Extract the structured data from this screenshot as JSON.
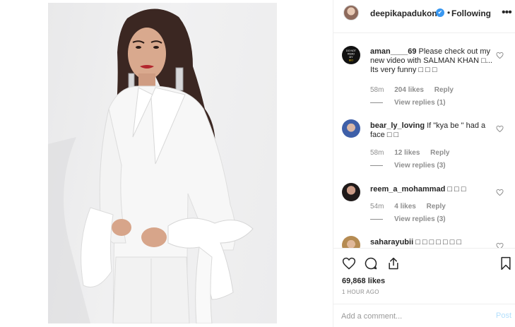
{
  "post": {
    "image_label": "Woman in white shirt with bow cuffs posing against a light gray background"
  },
  "header": {
    "username": "deepikapadukone",
    "dot": "•",
    "follow_status": "Following",
    "more_icon": "•••"
  },
  "comments": [
    {
      "username": "aman____69",
      "text": "Please check out my new video with SALMAN KHAN □... Its very funny □ □ □",
      "time": "58m",
      "likes": "204 likes",
      "reply": "Reply",
      "view_replies": "View replies (1)",
      "avatar_text": "DO NOT READ MY BIO"
    },
    {
      "username": "bear_ly_loving",
      "text": "If \"kya be \" had a face □ □",
      "time": "58m",
      "likes": "12 likes",
      "reply": "Reply",
      "view_replies": "View replies (3)"
    },
    {
      "username": "reem_a_mohammad",
      "text": "□ □ □",
      "time": "54m",
      "likes": "4 likes",
      "reply": "Reply",
      "view_replies": "View replies (3)"
    },
    {
      "username": "saharayubii",
      "text": "□ □ □ □ □ □ □"
    }
  ],
  "actions": {
    "likes": "69,868 likes",
    "time_ago": "1 HOUR AGO"
  },
  "comment_box": {
    "placeholder": "Add a comment...",
    "post_label": "Post"
  },
  "colors": {
    "accent": "#3897f0",
    "muted": "#8e8e8e",
    "border": "#efefef"
  }
}
